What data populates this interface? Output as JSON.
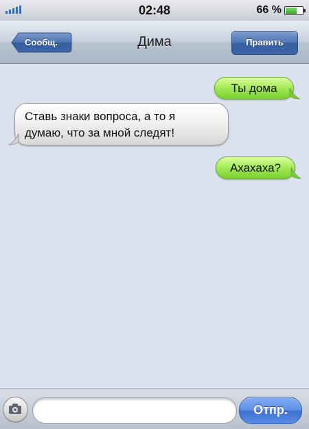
{
  "status": {
    "time": "02:48",
    "battery_text": "66 %",
    "battery_level": 0.66,
    "signal_bars": 5,
    "icons": [
      "signal-icon",
      "battery-icon"
    ]
  },
  "navbar": {
    "back_label": "Сообщ.",
    "title": "Дима",
    "edit_label": "Править"
  },
  "messages": [
    {
      "side": "right",
      "text": "Ты дома"
    },
    {
      "side": "left",
      "text": "Ставь знаки вопроса, а то я\nдумаю, что за мной следят!"
    },
    {
      "side": "right",
      "text": "Ахахаха?"
    }
  ],
  "compose": {
    "input_value": "",
    "send_label": "Отпр.",
    "camera_icon": "camera-icon"
  },
  "colors": {
    "chat_bg": "#dbe2ed",
    "outgoing_bubble": "#a8ec5a",
    "incoming_bubble": "#f1f1f1",
    "accent": "#4f74b3"
  }
}
